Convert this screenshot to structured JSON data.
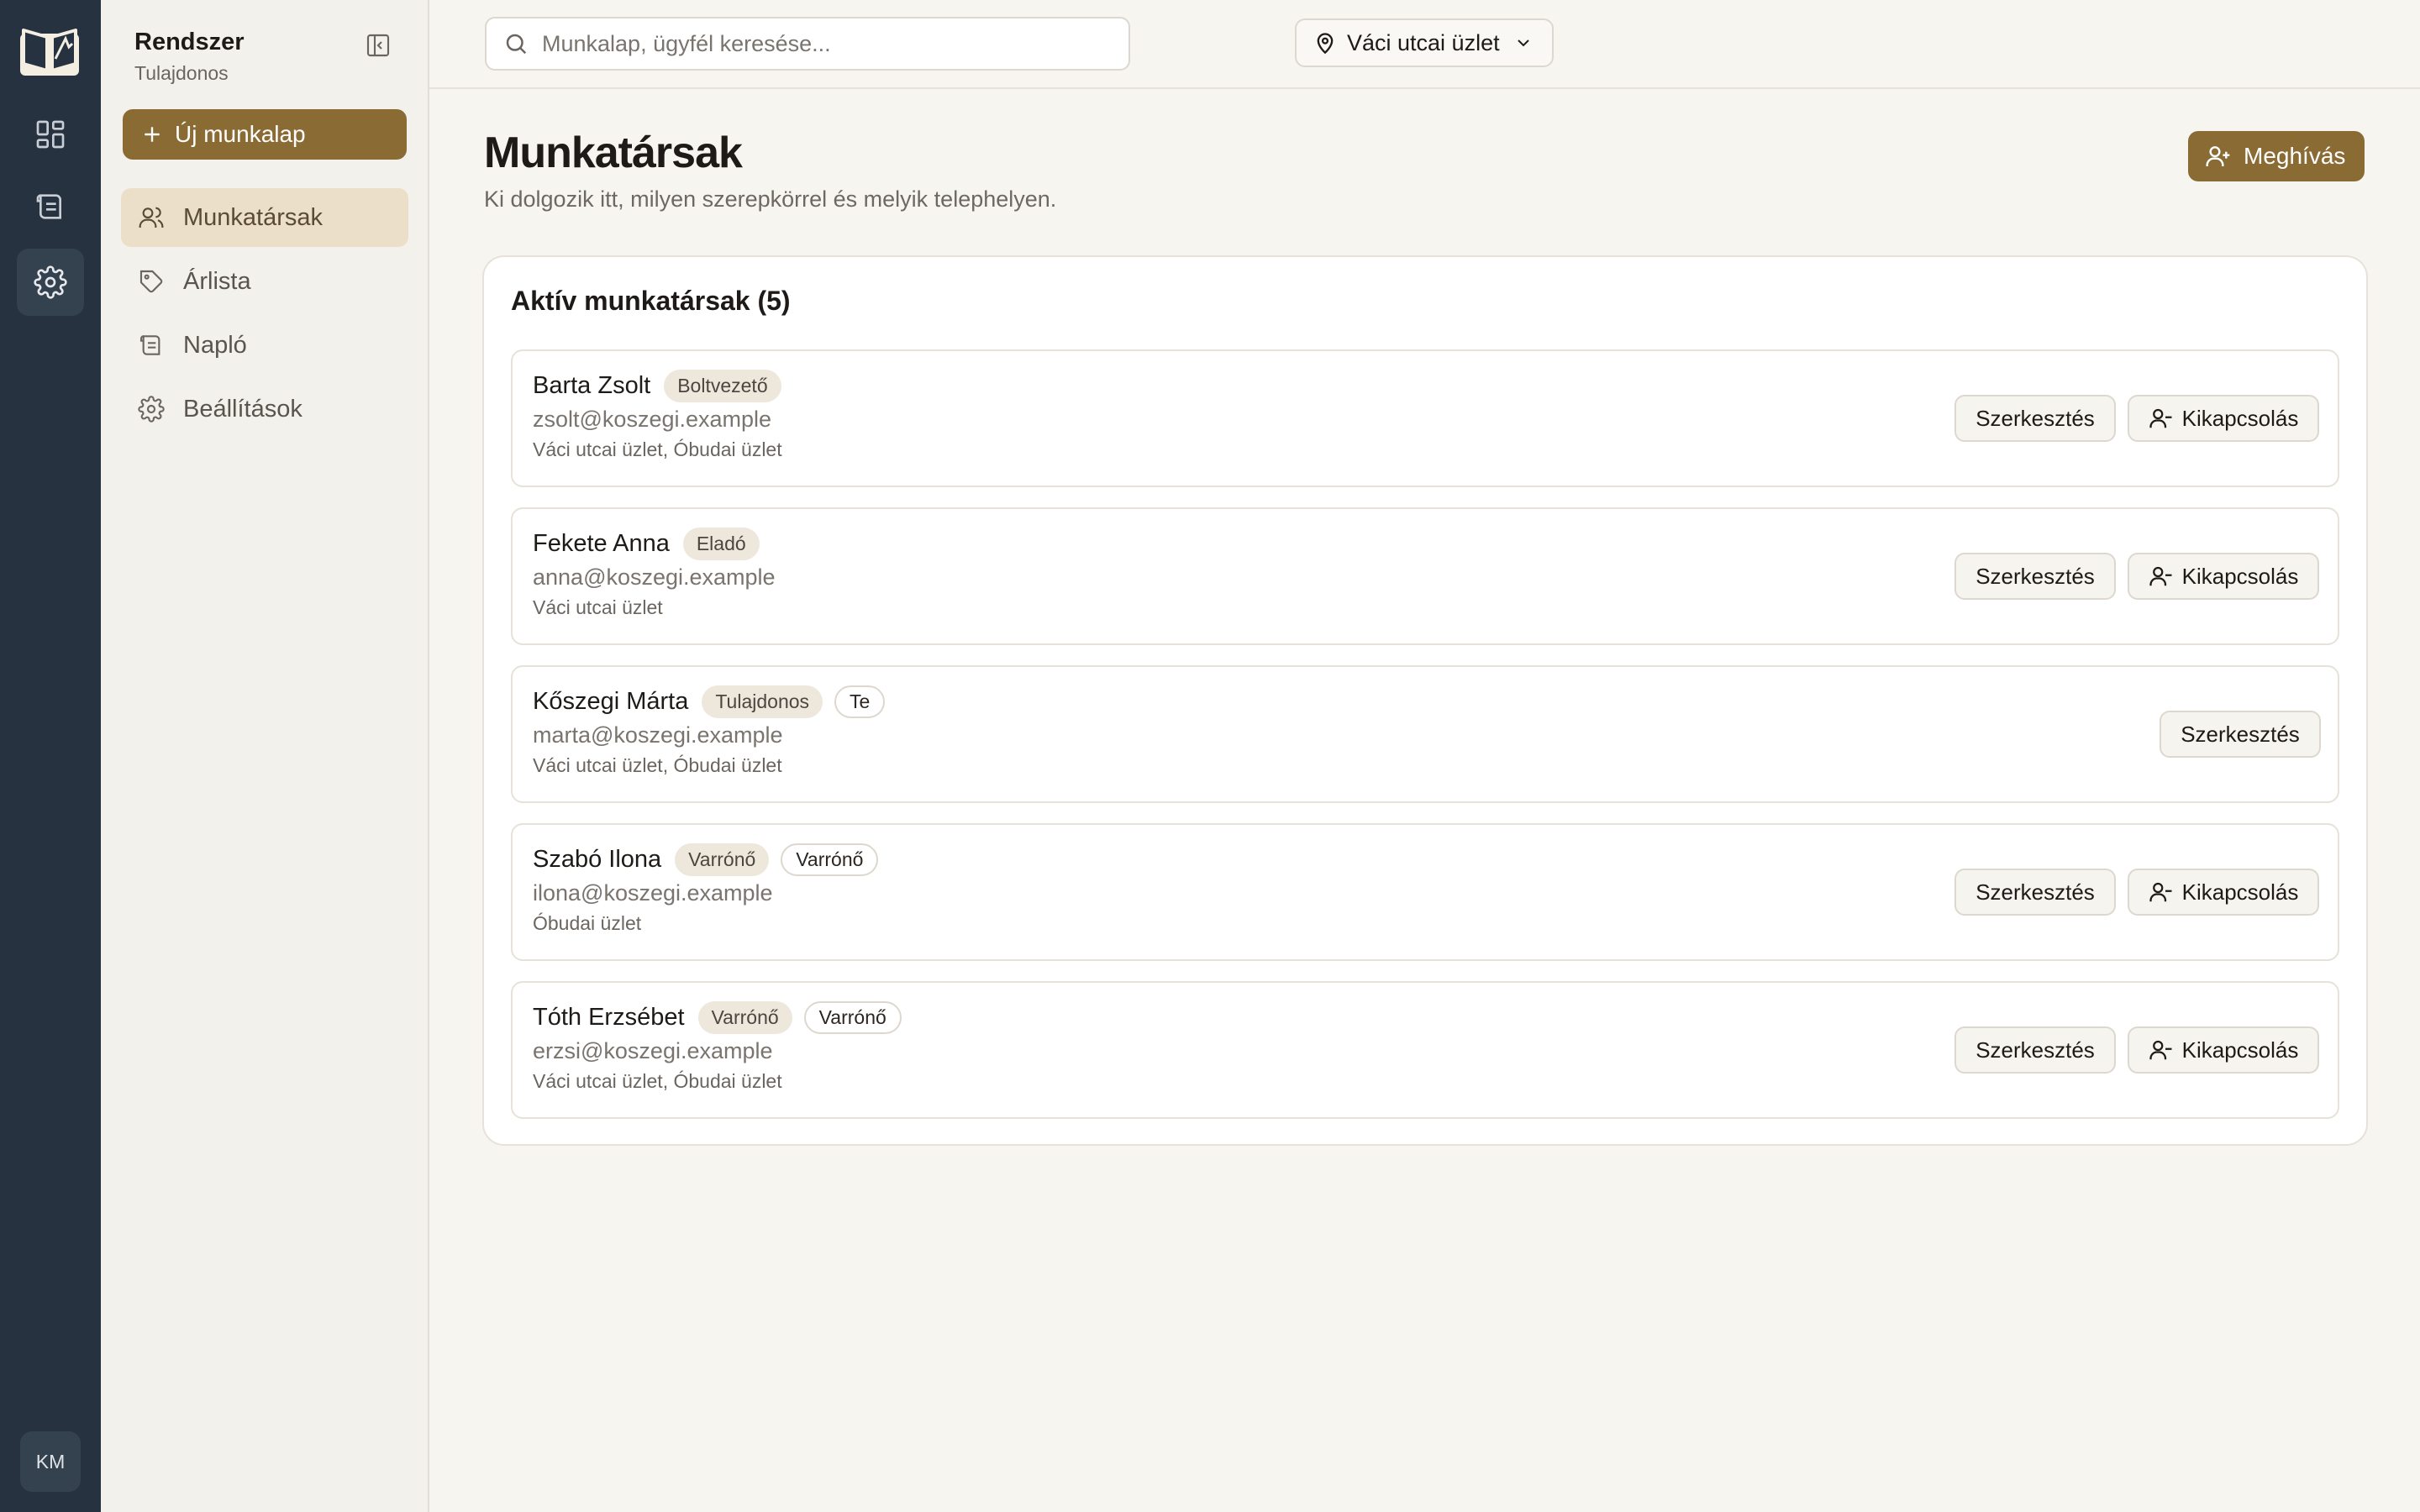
{
  "rail": {
    "items": [
      {
        "icon": "dashboard-icon"
      },
      {
        "icon": "worksheet-icon"
      },
      {
        "icon": "settings-icon",
        "active": true
      }
    ],
    "avatar_initials": "KM"
  },
  "sidebar": {
    "title": "Rendszer",
    "subtitle": "Tulajdonos",
    "new_button": "Új munkalap",
    "items": [
      {
        "label": "Munkatársak",
        "icon": "users-icon",
        "active": true
      },
      {
        "label": "Árlista",
        "icon": "tag-icon"
      },
      {
        "label": "Napló",
        "icon": "scroll-icon"
      },
      {
        "label": "Beállítások",
        "icon": "gear-icon"
      }
    ]
  },
  "topbar": {
    "search_placeholder": "Munkalap, ügyfél keresése...",
    "location": "Váci utcai üzlet"
  },
  "page": {
    "title": "Munkatársak",
    "subtitle": "Ki dolgozik itt, milyen szerepkörrel és melyik telephelyen.",
    "invite_button": "Meghívás"
  },
  "staff": {
    "heading": "Aktív munkatársak (5)",
    "edit_label": "Szerkesztés",
    "deactivate_label": "Kikapcsolás",
    "members": [
      {
        "name": "Barta Zsolt",
        "badges": [
          {
            "text": "Boltvezető",
            "style": "filled"
          }
        ],
        "email": "zsolt@koszegi.example",
        "locations": "Váci utcai üzlet, Óbudai üzlet",
        "can_deactivate": true
      },
      {
        "name": "Fekete Anna",
        "badges": [
          {
            "text": "Eladó",
            "style": "filled"
          }
        ],
        "email": "anna@koszegi.example",
        "locations": "Váci utcai üzlet",
        "can_deactivate": true
      },
      {
        "name": "Kőszegi Márta",
        "badges": [
          {
            "text": "Tulajdonos",
            "style": "filled"
          },
          {
            "text": "Te",
            "style": "outline"
          }
        ],
        "email": "marta@koszegi.example",
        "locations": "Váci utcai üzlet, Óbudai üzlet",
        "can_deactivate": false
      },
      {
        "name": "Szabó Ilona",
        "badges": [
          {
            "text": "Varrónő",
            "style": "filled"
          },
          {
            "text": "Varrónő",
            "style": "outline"
          }
        ],
        "email": "ilona@koszegi.example",
        "locations": "Óbudai üzlet",
        "can_deactivate": true
      },
      {
        "name": "Tóth Erzsébet",
        "badges": [
          {
            "text": "Varrónő",
            "style": "filled"
          },
          {
            "text": "Varrónő",
            "style": "outline"
          }
        ],
        "email": "erzsi@koszegi.example",
        "locations": "Váci utcai üzlet, Óbudai üzlet",
        "can_deactivate": true
      }
    ]
  },
  "colors": {
    "accent": "#8a6b34",
    "rail_bg": "#263240",
    "page_bg": "#f7f5f0"
  }
}
